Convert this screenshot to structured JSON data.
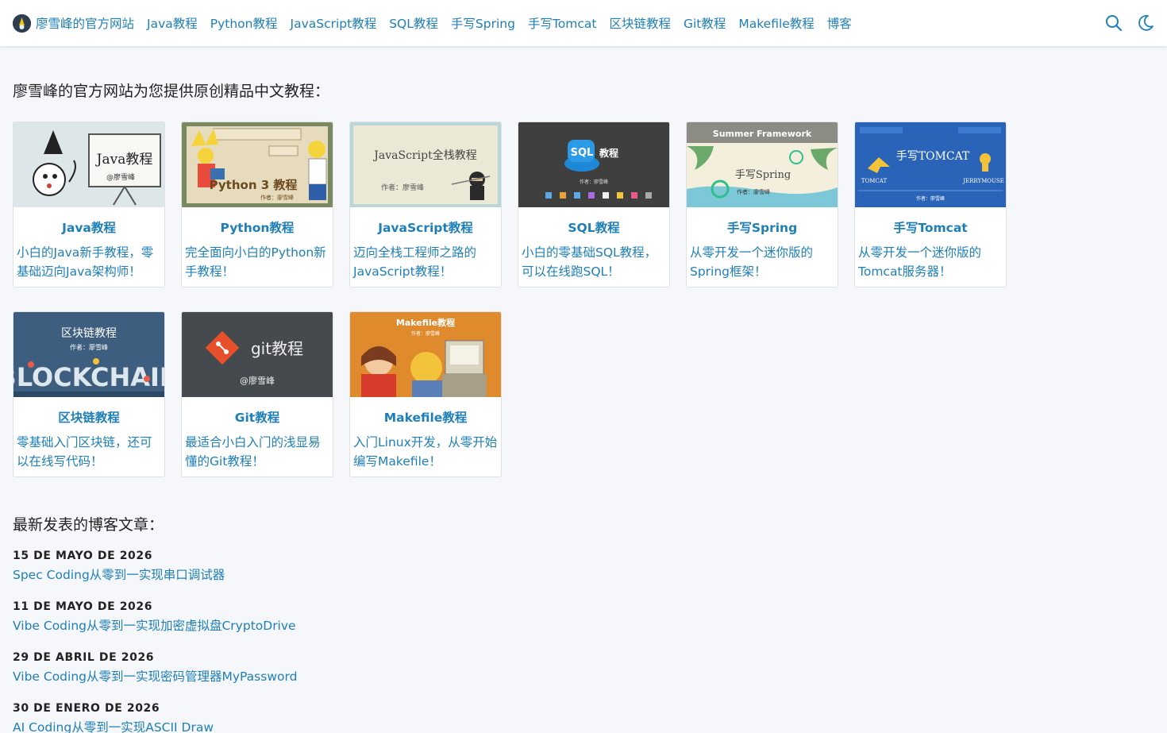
{
  "nav": {
    "brand": "廖雪峰的官方网站",
    "links": [
      "Java教程",
      "Python教程",
      "JavaScript教程",
      "SQL教程",
      "手写Spring",
      "手写Tomcat",
      "区块链教程",
      "Git教程",
      "Makefile教程",
      "博客"
    ],
    "icons": [
      "search-icon",
      "moon-icon"
    ]
  },
  "intro": "廖雪峰的官方网站为您提供原创精品中文教程：",
  "courses": [
    {
      "title": "Java教程",
      "desc": "小白的Java新手教程，零基础迈向Java架构师！",
      "img_text": "Java教程",
      "img_sub": "@廖雪峰"
    },
    {
      "title": "Python教程",
      "desc": "完全面向小白的Python新手教程！",
      "img_text": "Python 3 教程",
      "img_sub": "作者：廖雪峰"
    },
    {
      "title": "JavaScript教程",
      "desc": "迈向全栈工程师之路的JavaScript教程！",
      "img_text": "JavaScript全栈教程",
      "img_sub": "作者：廖雪峰"
    },
    {
      "title": "SQL教程",
      "desc": "小白的零基础SQL教程，可以在线跑SQL！",
      "img_text": "教程",
      "img_sub": "作者：廖雪峰",
      "img_badge": "SQL"
    },
    {
      "title": "手写Spring",
      "desc": "从零开发一个迷你版的Spring框架！",
      "img_text": "手写Spring",
      "img_sub": "作者：廖雪峰",
      "img_top": "Summer Framework"
    },
    {
      "title": "手写Tomcat",
      "desc": "从零开发一个迷你版的Tomcat服务器！",
      "img_text": "手写TOMCAT",
      "img_sub": "作者：廖雪峰",
      "img_left": "TOMCAT",
      "img_right": "JERRYMOUSE"
    },
    {
      "title": "区块链教程",
      "desc": "零基础入门区块链，还可以在线写代码！",
      "img_text": "区块链教程",
      "img_sub": "作者：廖雪峰",
      "img_big": "BLOCKCHAIN"
    },
    {
      "title": "Git教程",
      "desc": "最适合小白入门的浅显易懂的Git教程！",
      "img_text": "git教程",
      "img_sub": "@廖雪峰"
    },
    {
      "title": "Makefile教程",
      "desc": "入门Linux开发，从零开始编写Makefile！",
      "img_text": "Makefile教程",
      "img_sub": "作者：廖雪峰"
    }
  ],
  "blog_heading": "最新发表的博客文章：",
  "posts": [
    {
      "date": "15 DE MAYO DE 2026",
      "title": "Spec Coding从零到一实现串口调试器"
    },
    {
      "date": "11 DE MAYO DE 2026",
      "title": "Vibe Coding从零到一实现加密虚拟盘CryptoDrive"
    },
    {
      "date": "29 DE ABRIL DE 2026",
      "title": "Vibe Coding从零到一实现密码管理器MyPassword"
    },
    {
      "date": "30 DE ENERO DE 2026",
      "title": "AI Coding从零到一实现ASCII Draw"
    }
  ],
  "colors": {
    "link": "#1e7fb8",
    "background": "#f5f7fa"
  }
}
